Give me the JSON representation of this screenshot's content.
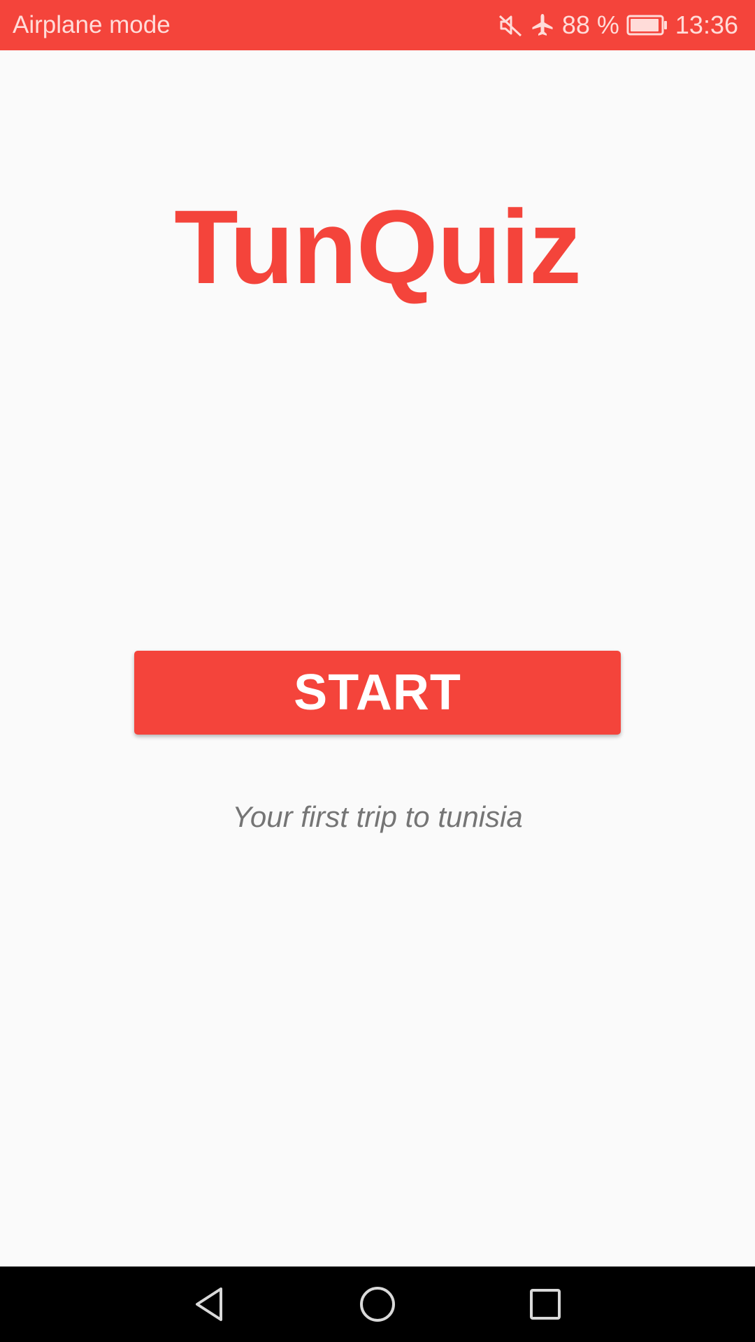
{
  "status_bar": {
    "left_text": "Airplane mode",
    "battery": "88 %",
    "time": "13:36",
    "icons": [
      "mute-icon",
      "airplane-icon",
      "battery-icon"
    ]
  },
  "main": {
    "title": "TunQuiz",
    "start_label": "START",
    "tagline": "Your first trip to tunisia"
  },
  "nav_bar": {
    "buttons": [
      "back-icon",
      "home-icon",
      "recents-icon"
    ]
  },
  "colors": {
    "accent": "#f4443b",
    "background": "#fafafa",
    "tagline": "#757575",
    "nav_bar": "#000000"
  }
}
